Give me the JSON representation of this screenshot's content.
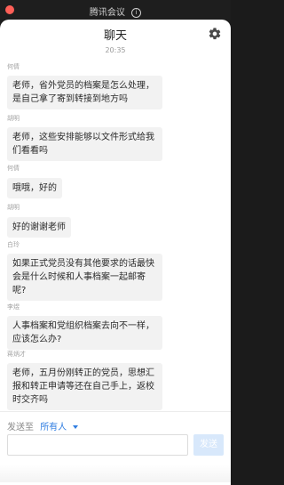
{
  "topbar": {
    "title": "腾讯会议",
    "info_icon": "info-icon"
  },
  "chat": {
    "title": "聊天",
    "settings_icon": "gear-icon",
    "time": "20:35",
    "messages": [
      {
        "sender": "何倩",
        "text": "老师，省外党员的档案是怎么处理，是自己拿了寄到转接到地方吗"
      },
      {
        "sender": "胡明",
        "text": "老师，这些安排能够以文件形式给我们看看吗"
      },
      {
        "sender": "何倩",
        "text": "哦哦，好的"
      },
      {
        "sender": "胡明",
        "text": "好的谢谢老师"
      },
      {
        "sender": "白玲",
        "text": "如果正式党员没有其他要求的话最快会是什么时候和人事档案一起邮寄呢?"
      },
      {
        "sender": "李煜",
        "text": "人事档案和党组织档案去向不一样，应该怎么办?"
      },
      {
        "sender": "蒋炳才",
        "text": "老师，五月份刚转正的党员，思想汇报和转正申请等还在自己手上，返校时交齐吗"
      }
    ]
  },
  "composer": {
    "send_to_label": "发送至",
    "send_to_value": "所有人",
    "input_placeholder": "",
    "send_label": "发送"
  }
}
